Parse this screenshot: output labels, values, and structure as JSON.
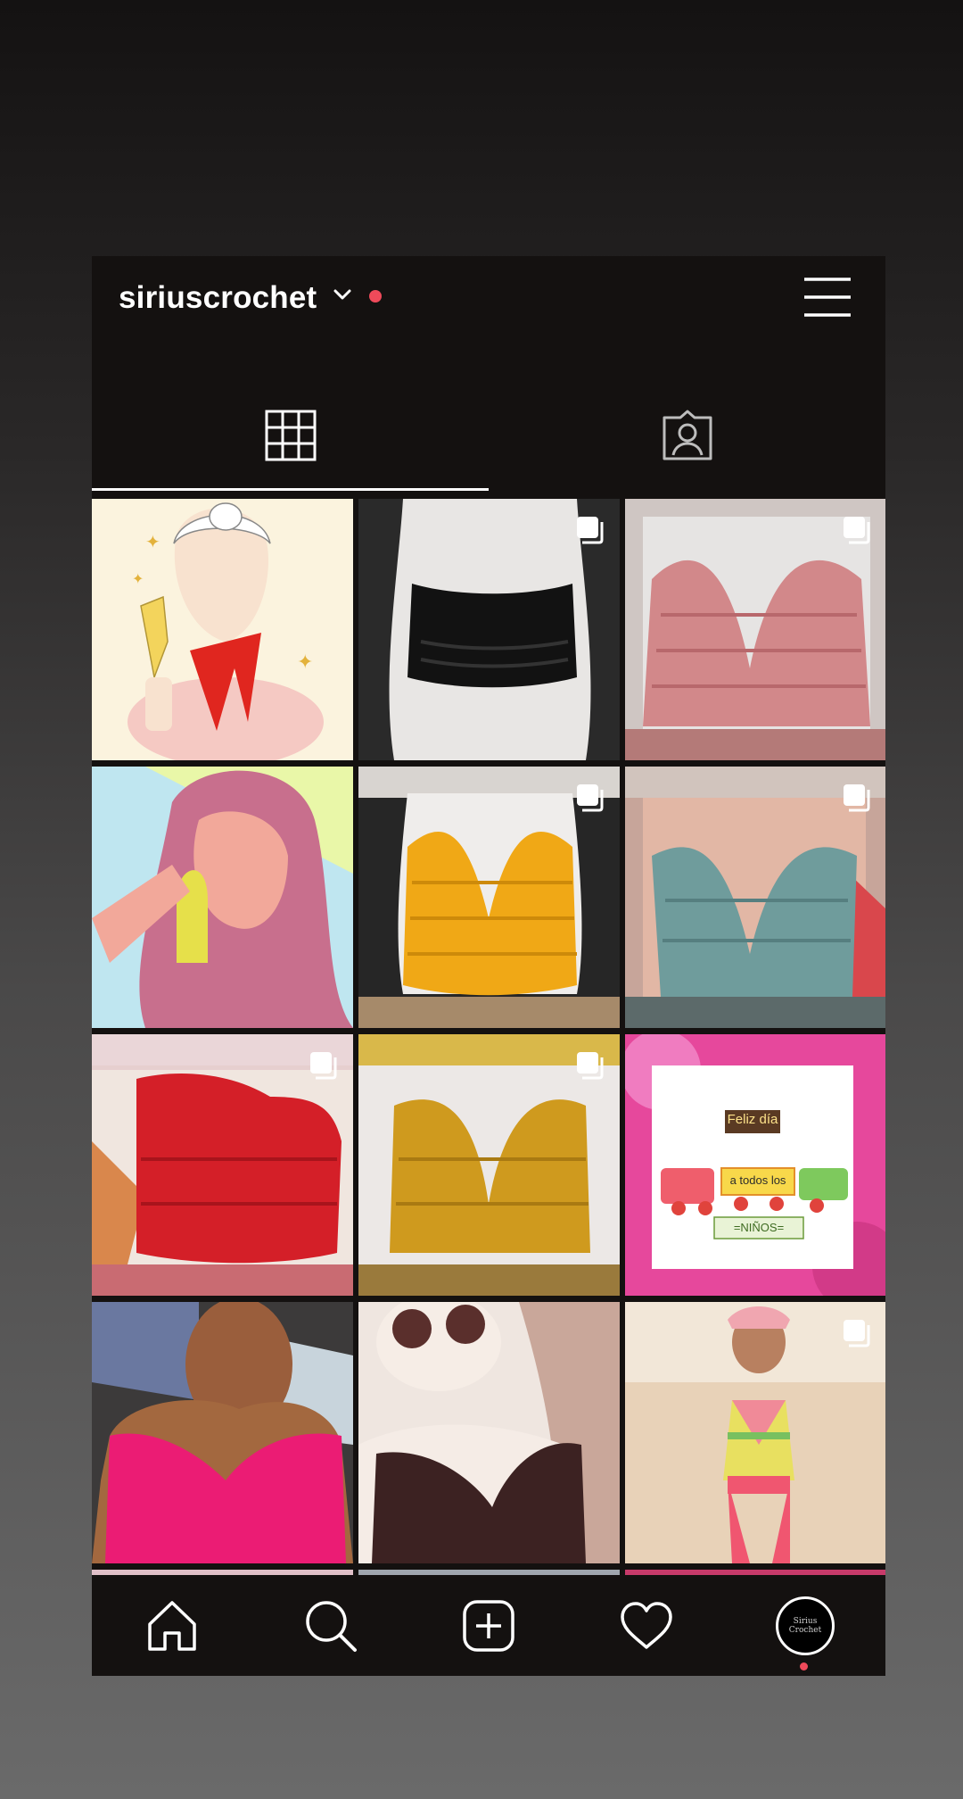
{
  "header": {
    "username": "siriuscrochet",
    "account_switch_icon": "chevron-down-icon",
    "notification_dot_color": "#ef4a5a",
    "menu_icon": "hamburger-menu-icon"
  },
  "tabs": [
    {
      "name": "posts-grid",
      "icon": "grid-icon",
      "selected": true
    },
    {
      "name": "tagged",
      "icon": "tagged-person-icon",
      "selected": false
    }
  ],
  "posts": [
    {
      "subject": "illustration woman with champagne and red scarf",
      "multiple": false
    },
    {
      "subject": "black crochet bandeau top on mannequin",
      "multiple": true
    },
    {
      "subject": "pink crochet bralette on mannequin",
      "multiple": true
    },
    {
      "subject": "illustration woman with long purple hair",
      "multiple": false
    },
    {
      "subject": "yellow crochet halter top on mannequin",
      "multiple": true
    },
    {
      "subject": "teal crochet bralette on mannequin",
      "multiple": true
    },
    {
      "subject": "red crochet top on mannequin",
      "multiple": true
    },
    {
      "subject": "mustard crochet top on mannequin",
      "multiple": true
    },
    {
      "subject": "children's day greeting card",
      "multiple": false,
      "card_text": [
        "Feliz día",
        "a todos los",
        "=NIÑOS="
      ]
    },
    {
      "subject": "woman wearing pink crochet top",
      "multiple": false
    },
    {
      "subject": "woman wearing brown crochet top",
      "multiple": false
    },
    {
      "subject": "child wearing colorful crochet top",
      "multiple": true
    }
  ],
  "bottom_nav": [
    {
      "name": "home",
      "icon": "home-icon"
    },
    {
      "name": "search",
      "icon": "search-icon"
    },
    {
      "name": "new-post",
      "icon": "add-post-icon"
    },
    {
      "name": "activity",
      "icon": "heart-icon"
    },
    {
      "name": "profile",
      "icon": "profile-avatar",
      "avatar_text": "Sirius Crochet"
    }
  ],
  "colors": {
    "background": "#141110",
    "accent": "#ef4a5a",
    "icon": "#ffffff"
  }
}
